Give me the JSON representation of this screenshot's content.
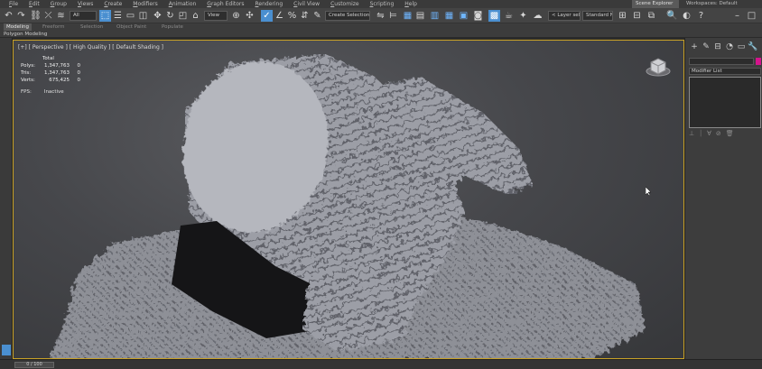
{
  "menu": [
    "File",
    "Edit",
    "Group",
    "Views",
    "Create",
    "Modifiers",
    "Animation",
    "Graph Editors",
    "Rendering",
    "Civil View",
    "Customize",
    "Scripting",
    "Help"
  ],
  "workspace": {
    "label": "Scene Explorer",
    "name": "Workspaces: Default"
  },
  "toolbar": {
    "filter_dropdown": "All",
    "view_dropdown": "View",
    "selection_set": "Create Selection Se",
    "layer_dropdown": "< Layer select >",
    "standard_dropdown": "Standard   Nodes"
  },
  "ribbon_tabs": [
    "Modeling",
    "Freeform",
    "Selection",
    "Object Paint",
    "Populate"
  ],
  "sub_ribbon": "Polygon Modeling",
  "viewport": {
    "label": "[+] [ Perspective ] [ High Quality ] [ Default Shading ]",
    "stats_header": "Total",
    "stats": [
      {
        "label": "Polys:",
        "value": "1,347,763",
        "sel": "0"
      },
      {
        "label": "Tris:",
        "value": "1,347,763",
        "sel": "0"
      },
      {
        "label": "Verts:",
        "value": "675,425",
        "sel": "0"
      }
    ],
    "fps_label": "FPS:",
    "fps_value": "Inactive"
  },
  "command_panel": {
    "tabs": [
      "+",
      "✎",
      "⊟",
      "◔",
      "▭",
      "🔧"
    ],
    "modifier_list": "Modifier List",
    "swatch_color": "#d4148c"
  },
  "status": {
    "time_slider": "0 / 100"
  },
  "colors": {
    "selection_blue": "#4a8fd0",
    "viewport_border": "#c9a227"
  }
}
